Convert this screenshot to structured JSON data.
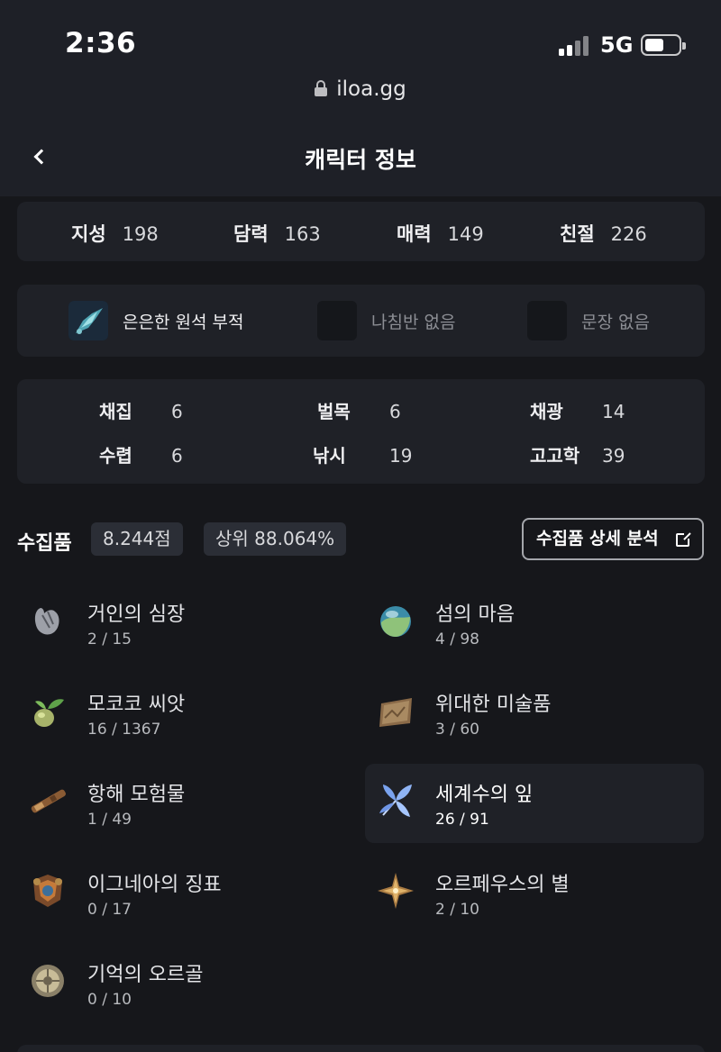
{
  "status_bar": {
    "time": "2:36",
    "network": "5G",
    "battery_level": 0.6
  },
  "browser": {
    "url": "iloa.gg"
  },
  "header": {
    "title": "캐릭터 정보"
  },
  "stats": [
    {
      "label": "지성",
      "value": "198"
    },
    {
      "label": "담력",
      "value": "163"
    },
    {
      "label": "매력",
      "value": "149"
    },
    {
      "label": "친절",
      "value": "226"
    }
  ],
  "equipment": [
    {
      "label": "은은한 원석 부적",
      "empty": false
    },
    {
      "label": "나침반 없음",
      "empty": true
    },
    {
      "label": "문장 없음",
      "empty": true
    }
  ],
  "life_skills": [
    {
      "label": "채집",
      "value": "6"
    },
    {
      "label": "벌목",
      "value": "6"
    },
    {
      "label": "채광",
      "value": "14"
    },
    {
      "label": "수렵",
      "value": "6"
    },
    {
      "label": "낚시",
      "value": "19"
    },
    {
      "label": "고고학",
      "value": "39"
    }
  ],
  "collectibles": {
    "title": "수집품",
    "score": "8.244점",
    "rank": "상위 88.064%",
    "detail_button": "수집품 상세 분석",
    "items": [
      {
        "name": "거인의 심장",
        "count": "2 / 15",
        "icon": "giant-heart-icon"
      },
      {
        "name": "섬의 마음",
        "count": "4 / 98",
        "icon": "island-heart-icon"
      },
      {
        "name": "모코코 씨앗",
        "count": "16 / 1367",
        "icon": "mokoko-seed-icon"
      },
      {
        "name": "위대한 미술품",
        "count": "3 / 60",
        "icon": "artwork-icon"
      },
      {
        "name": "항해 모험물",
        "count": "1 / 49",
        "icon": "spyglass-icon"
      },
      {
        "name": "세계수의 잎",
        "count": "26 / 91",
        "icon": "world-tree-leaf-icon"
      },
      {
        "name": "이그네아의 징표",
        "count": "0 / 17",
        "icon": "ignea-token-icon"
      },
      {
        "name": "오르페우스의 별",
        "count": "2 / 10",
        "icon": "orpheus-star-icon"
      },
      {
        "name": "기억의 오르골",
        "count": "0 / 10",
        "icon": "music-box-icon"
      }
    ]
  }
}
